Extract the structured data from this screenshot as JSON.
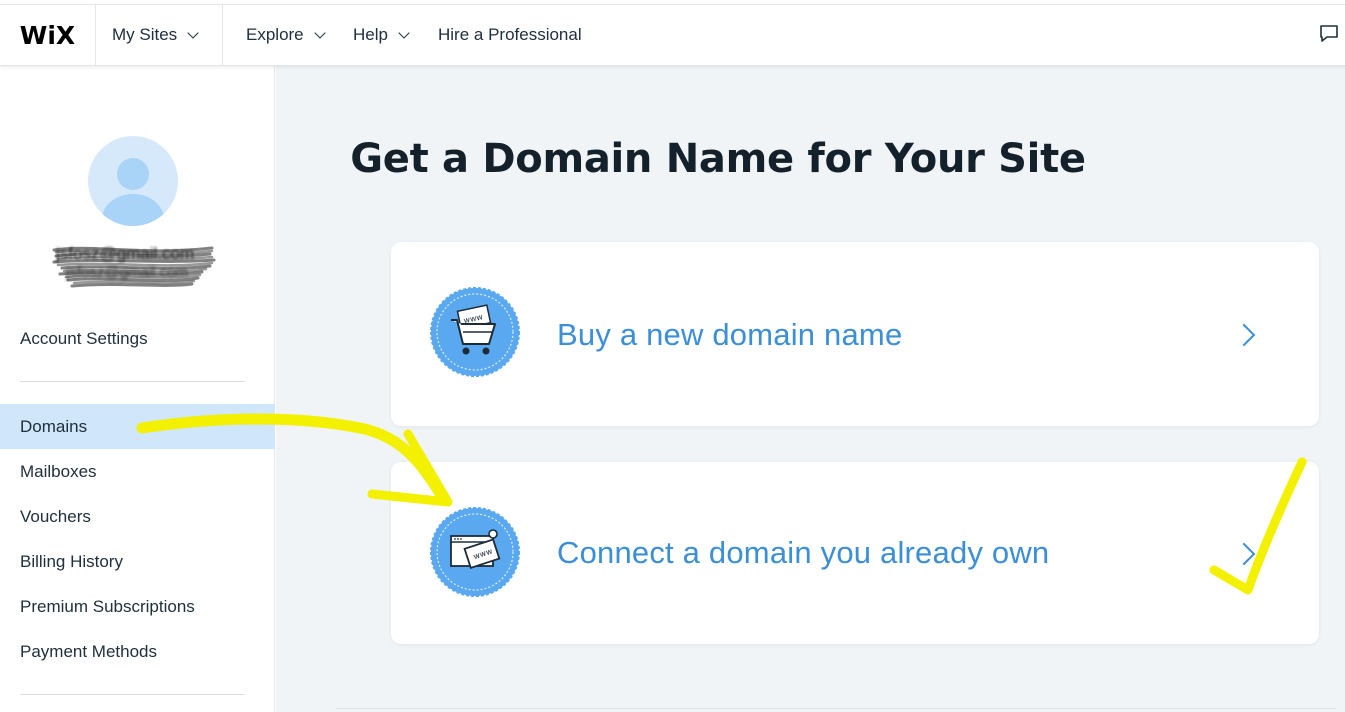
{
  "app": {
    "logo": "WiX"
  },
  "topbar": {
    "my_sites": "My Sites",
    "explore": "Explore",
    "help": "Help",
    "hire": "Hire a Professional"
  },
  "sidebar": {
    "email_line1": "jsfosz@gmail.com",
    "email_line2": "jsfosz@gmail.com",
    "account_settings": "Account Settings",
    "items": [
      {
        "label": "Domains",
        "active": true
      },
      {
        "label": "Mailboxes"
      },
      {
        "label": "Vouchers"
      },
      {
        "label": "Billing History"
      },
      {
        "label": "Premium Subscriptions"
      },
      {
        "label": "Payment Methods"
      }
    ]
  },
  "main": {
    "title": "Get a Domain Name for Your Site",
    "options": [
      {
        "label": "Buy a new domain name",
        "icon": "shopping-cart-www-icon",
        "badge_text": "www"
      },
      {
        "label": "Connect a domain you already own",
        "icon": "browser-window-www-icon",
        "badge_text": "www"
      }
    ]
  },
  "colors": {
    "accent": "#3b8ed8",
    "active_item_bg": "#cfe6fb",
    "badge": "#5aa8ef",
    "annotation": "#f3f000"
  }
}
